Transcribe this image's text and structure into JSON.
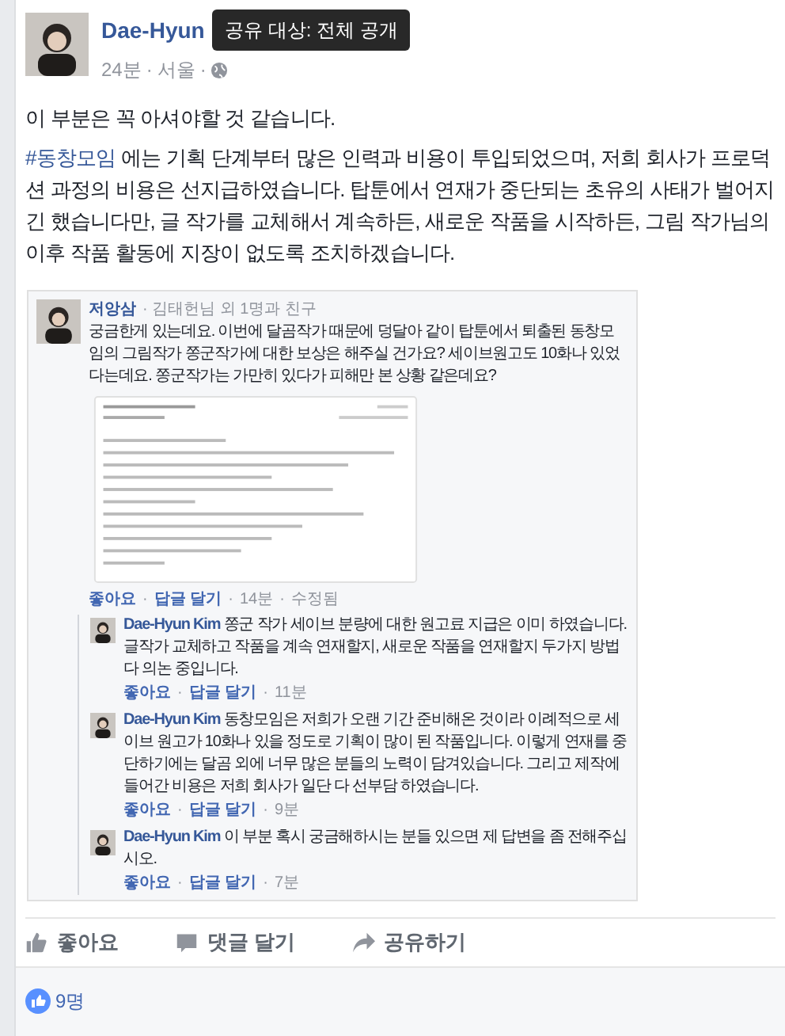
{
  "post": {
    "author": "Dae-Hyun",
    "meta": [
      "24분",
      "·",
      "서울",
      "·"
    ],
    "tooltip": "공유 대상: 전체 공개",
    "paragraphs": [
      "이 부분은 꼭 아셔야할 것 같습니다."
    ],
    "hashtag": "#동창모임",
    "body": " 에는 기획 단계부터 많은 인력과 비용이 투입되었으며, 저희 회사가 프로덕션 과정의 비용은 선지급하였습니다. 탑툰에서 연재가 중단되는 초유의 사태가 벌어지긴 했습니다만, 글 작가를 교체해서 계속하든, 새로운 작품을 시작하든, 그림 작가님의 이후 작품 활동에 지장이 없도록 조치하겠습니다."
  },
  "embedded_image": {
    "comment": {
      "author": "저앙삼",
      "context": "· 김태헌님 외 1명과 친구",
      "text": "궁금한게 있는데요. 이번에 달곰작가 때문에 덩달아 같이 탑툰에서 퇴출된 동창모임의 그림작가 쫑군작가에 대한 보상은 해주실 건가요? 세이브원고도 10화나 있었다는데요. 쫑군작가는 가만히 있다가 피해만 본 상황 같은데요?",
      "actions": [
        "좋아요",
        "·",
        "답글 달기",
        "·",
        "14분",
        "·",
        "수정됨"
      ]
    },
    "replies": [
      {
        "author": "Dae-Hyun Kim",
        "text": "쫑군 작가 세이브 분량에 대한 원고료 지급은 이미 하였습니다. 글작가 교체하고 작품을 계속 연재할지, 새로운 작품을 연재할지 두가지 방법 다 의논 중입니다.",
        "actions": [
          "좋아요",
          "·",
          "답글 달기",
          "·",
          "11분"
        ]
      },
      {
        "author": "Dae-Hyun Kim",
        "text": "동창모임은 저희가 오랜 기간 준비해온 것이라 이례적으로 세이브 원고가 10화나 있을 정도로 기획이 많이 된 작품입니다. 이렇게 연재를 중단하기에는 달곰 외에 너무 많은 분들의 노력이 담겨있습니다. 그리고 제작에 들어간 비용은 저희 회사가 일단 다 선부담 하였습니다.",
        "actions": [
          "좋아요",
          "·",
          "답글 달기",
          "·",
          "9분"
        ]
      },
      {
        "author": "Dae-Hyun Kim",
        "text": "이 부분 혹시 궁금해하시는 분들 있으면 제 답변을 좀 전해주십시오.",
        "actions": [
          "좋아요",
          "·",
          "답글 달기",
          "·",
          "7분"
        ]
      }
    ]
  },
  "actions": [
    {
      "kind": "like",
      "label": "좋아요"
    },
    {
      "kind": "comment",
      "label": "댓글 달기"
    },
    {
      "kind": "share",
      "label": "공유하기"
    }
  ],
  "likes": "9명"
}
